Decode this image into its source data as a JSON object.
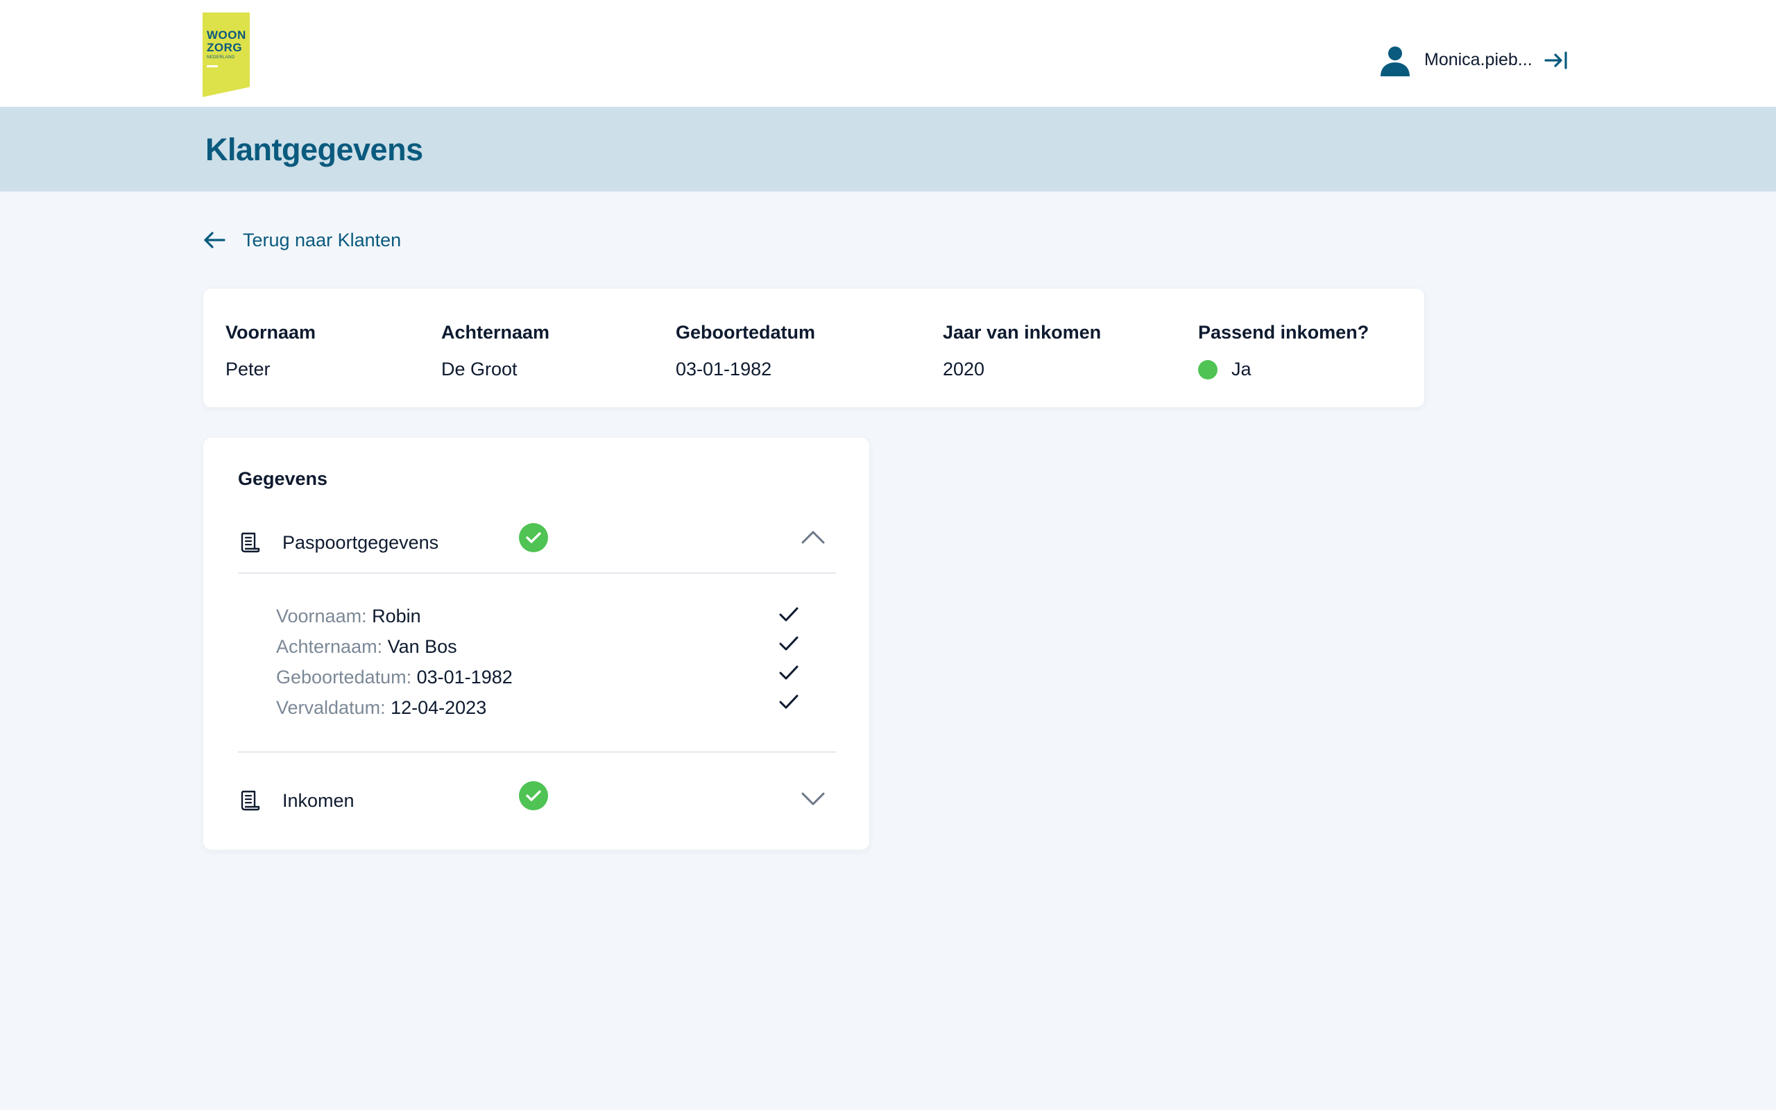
{
  "header": {
    "logo": {
      "line1": "WOON",
      "line2": "ZORG",
      "line3": "NEDERLAND"
    },
    "user_name": "Monica.pieb...",
    "icons": {
      "user": "user-icon",
      "logout": "logout-icon"
    }
  },
  "page": {
    "title": "Klantgegevens",
    "back_link": "Terug naar Klanten"
  },
  "summary": {
    "columns": [
      {
        "label": "Voornaam",
        "value": "Peter"
      },
      {
        "label": "Achternaam",
        "value": "De Groot"
      },
      {
        "label": "Geboortedatum",
        "value": "03-01-1982"
      },
      {
        "label": "Jaar van inkomen",
        "value": "2020"
      },
      {
        "label": "Passend inkomen?",
        "value": "Ja"
      }
    ]
  },
  "details": {
    "title": "Gegevens",
    "sections": [
      {
        "label": "Paspoortgegevens",
        "expanded": true,
        "rows": [
          {
            "key": "Voornaam:",
            "value": "Robin"
          },
          {
            "key": "Achternaam:",
            "value": "Van Bos"
          },
          {
            "key": "Geboortedatum:",
            "value": "03-01-1982"
          },
          {
            "key": "Vervaldatum:",
            "value": "12-04-2023"
          }
        ]
      },
      {
        "label": "Inkomen",
        "expanded": false
      }
    ]
  },
  "colors": {
    "brand": "#0a5a7e",
    "logo_yellow": "#dde14a",
    "success": "#4fc353",
    "title_band": "#cddfe8",
    "page_bg": "#f3f7fb"
  }
}
